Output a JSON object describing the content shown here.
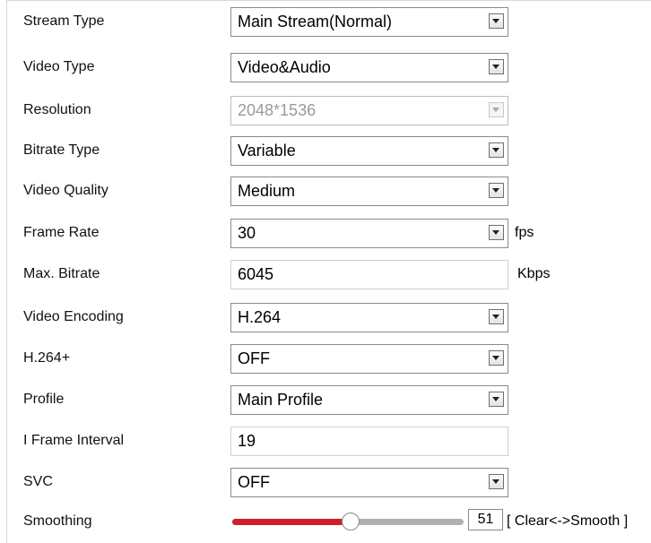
{
  "form": {
    "stream_type": {
      "label": "Stream Type",
      "value": "Main Stream(Normal)"
    },
    "video_type": {
      "label": "Video Type",
      "value": "Video&Audio"
    },
    "resolution": {
      "label": "Resolution",
      "value": "2048*1536",
      "disabled": true
    },
    "bitrate_type": {
      "label": "Bitrate Type",
      "value": "Variable"
    },
    "video_quality": {
      "label": "Video Quality",
      "value": "Medium"
    },
    "frame_rate": {
      "label": "Frame Rate",
      "value": "30",
      "unit": "fps"
    },
    "max_bitrate": {
      "label": "Max. Bitrate",
      "value": "6045",
      "unit": "Kbps"
    },
    "video_encoding": {
      "label": "Video Encoding",
      "value": "H.264"
    },
    "h264_plus": {
      "label": "H.264+",
      "value": "OFF"
    },
    "profile": {
      "label": "Profile",
      "value": "Main Profile"
    },
    "i_frame_interval": {
      "label": "I Frame Interval",
      "value": "19"
    },
    "svc": {
      "label": "SVC",
      "value": "OFF"
    },
    "smoothing": {
      "label": "Smoothing",
      "value": "51",
      "level": 0.51,
      "hint": "[ Clear<->Smooth ]"
    }
  },
  "colors": {
    "slider_fill": "#cc1f2a",
    "slider_track": "#b0b0b0"
  },
  "icons": {
    "dropdown": "chevron-down-icon"
  }
}
